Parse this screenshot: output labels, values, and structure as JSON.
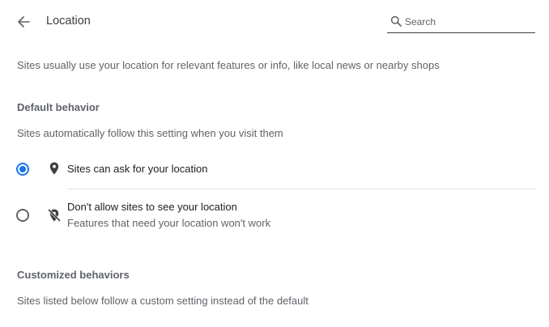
{
  "header": {
    "title": "Location",
    "search_placeholder": "Search"
  },
  "description": "Sites usually use your location for relevant features or info, like local news or nearby shops",
  "default_behavior": {
    "title": "Default behavior",
    "subtitle": "Sites automatically follow this setting when you visit them",
    "options": [
      {
        "label": "Sites can ask for your location",
        "icon": "location-pin-icon",
        "selected": true
      },
      {
        "label": "Don't allow sites to see your location",
        "sublabel": "Features that need your location won't work",
        "icon": "location-off-icon",
        "selected": false
      }
    ]
  },
  "customized_behaviors": {
    "title": "Customized behaviors",
    "subtitle": "Sites listed below follow a custom setting instead of the default"
  },
  "colors": {
    "accent": "#1a73e8",
    "text_primary": "#202124",
    "text_secondary": "#5f6368"
  }
}
